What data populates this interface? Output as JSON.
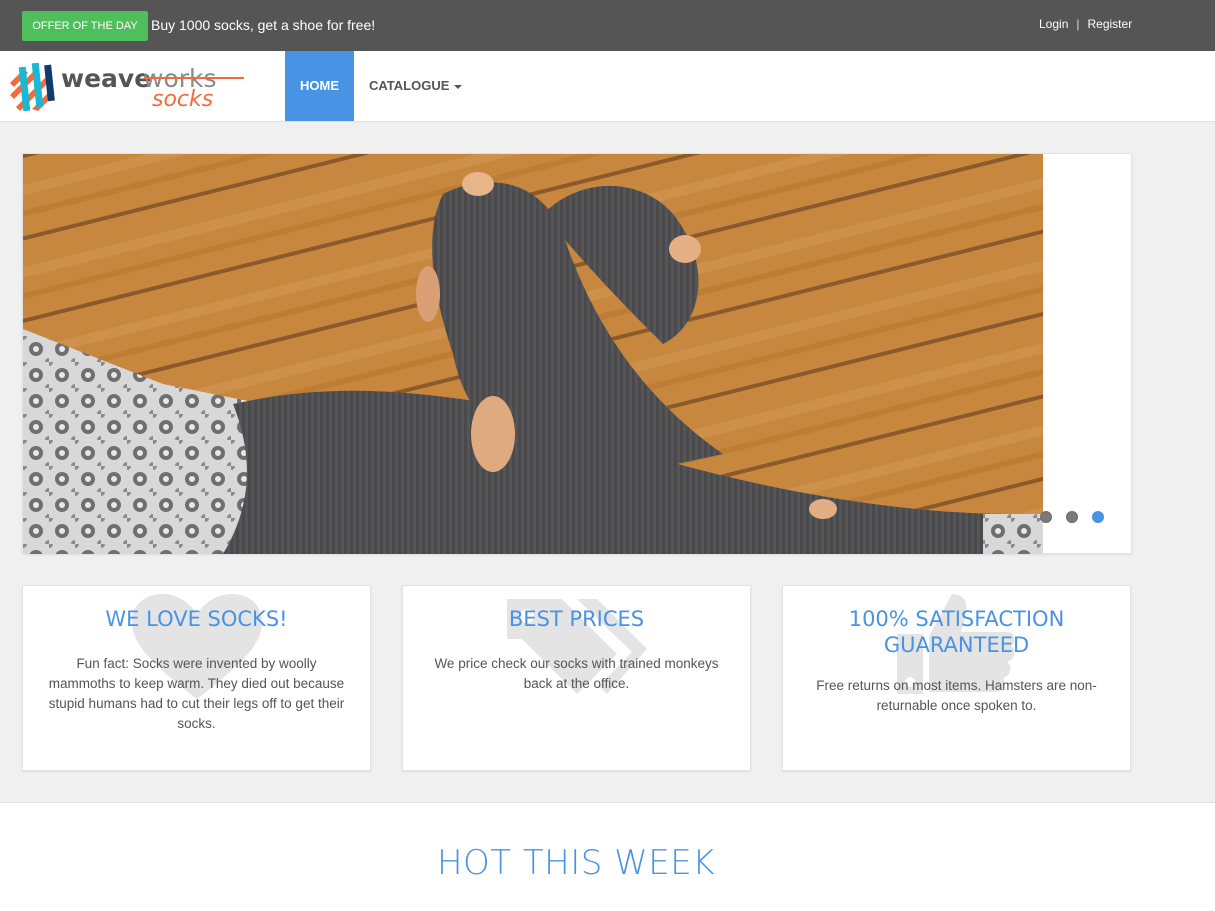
{
  "topbar": {
    "offer_label": "OFFER OF THE DAY",
    "offer_text": "Buy 1000 socks, get a shoe for free!",
    "login": "Login",
    "separator": "|",
    "register": "Register"
  },
  "logo": {
    "icon": "weaveworks-logo-icon",
    "word1": "weave",
    "word2": "works",
    "word3": "socks"
  },
  "nav": {
    "home": "HOME",
    "catalogue": "CATALOGUE"
  },
  "carousel": {
    "slide_image": "holey-socks-on-wooden-deck-photo",
    "dots": 3,
    "active_dot": 3
  },
  "features": [
    {
      "title": "WE LOVE SOCKS!",
      "text": "Fun fact: Socks were invented by woolly mammoths to keep warm. They died out because stupid humans had to cut their legs off to get their socks.",
      "icon": "heart-icon"
    },
    {
      "title": "BEST PRICES",
      "text": "We price check our socks with trained monkeys back at the office.",
      "icon": "tags-icon"
    },
    {
      "title": "100% SATISFACTION GUARANTEED",
      "text": "Free returns on most items. Hamsters are non-returnable once spoken to.",
      "icon": "thumbs-up-icon"
    }
  ],
  "hot": {
    "title": "HOT THIS WEEK"
  },
  "colors": {
    "accent": "#4993e4",
    "offer_green": "#4fbf5b",
    "topbar": "#555555"
  }
}
